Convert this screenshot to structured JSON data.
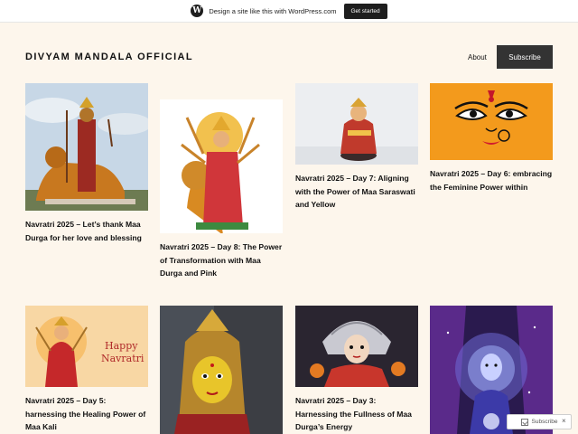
{
  "promo": {
    "logo": "W",
    "text": "Design a site like this with WordPress.com",
    "button": "Get started"
  },
  "header": {
    "site_title": "DIVYAM MANDALA OFFICIAL",
    "nav_about": "About",
    "nav_subscribe": "Subscribe"
  },
  "posts": [
    {
      "title": "Navratri 2025 – Let’s thank Maa Durga for her love and blessing",
      "image": "durga-statue-lion-photo"
    },
    {
      "title": "Navratri 2025 – Day 8: The Power of Transformation with Maa Durga and Pink",
      "image": "durga-illustration-lion"
    },
    {
      "title": "Navratri 2025 – Day 7: Aligning with the Power of Maa Saraswati and Yellow",
      "image": "saraswati-figurine-photo"
    },
    {
      "title": "Navratri 2025 – Day 6: embracing the Feminine Power within",
      "image": "durga-face-art-orange"
    },
    {
      "title": "Navratri 2025 – Day 5: harnessing the Healing Power of Maa Kali",
      "image": "happy-navratri-card",
      "image_text": [
        "Happy",
        "Navratri"
      ]
    },
    {
      "title": "",
      "image": "golden-durga-idol-photo"
    },
    {
      "title": "Navratri 2025 – Day 3: Harnessing the Fullness of Maa Durga’s Energy",
      "image": "durga-idol-silver-crown-photo"
    },
    {
      "title": "",
      "image": "glowing-goddess-purple-art"
    }
  ],
  "floating": {
    "subscribe": "Subscribe",
    "close": "×"
  },
  "colors": {
    "background": "#fdf6ec",
    "button_dark": "#333333",
    "text": "#111111"
  }
}
